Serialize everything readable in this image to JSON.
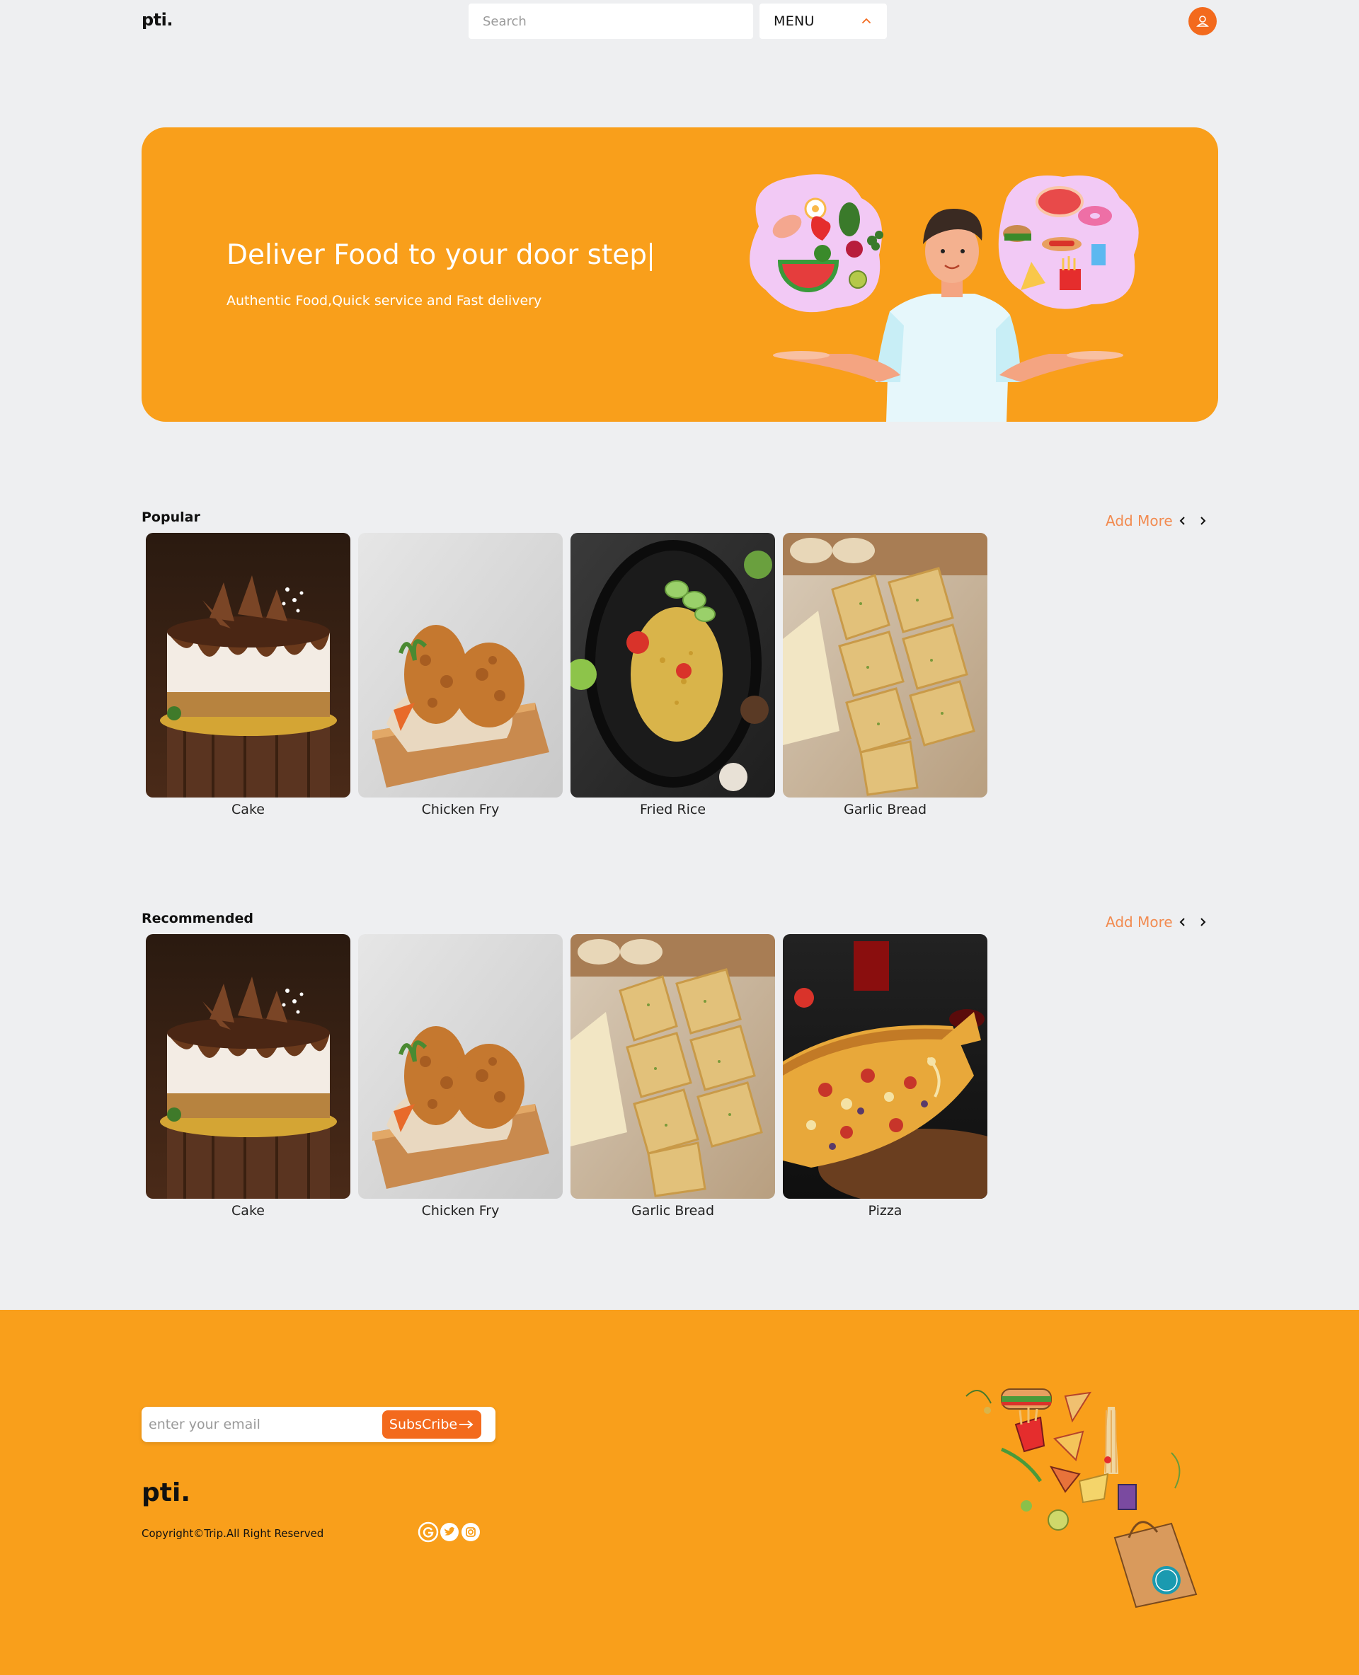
{
  "header": {
    "logo": "pti.",
    "search_placeholder": "Search",
    "menu_label": "MENU"
  },
  "hero": {
    "title": "Deliver Food to your door step",
    "subtitle": "Authentic Food,Quick service and Fast delivery"
  },
  "popular": {
    "title": "Popular",
    "add_more": "Add More",
    "items": [
      {
        "label": "Cake"
      },
      {
        "label": "Chicken Fry"
      },
      {
        "label": "Fried Rice"
      },
      {
        "label": "Garlic Bread"
      }
    ]
  },
  "recommended": {
    "title": "Recommended",
    "add_more": "Add More",
    "items": [
      {
        "label": "Cake"
      },
      {
        "label": "Chicken Fry"
      },
      {
        "label": "Garlic Bread"
      },
      {
        "label": "Pizza"
      }
    ]
  },
  "footer": {
    "email_placeholder": "enter your email",
    "subscribe_label": "SubsCribe",
    "logo": "pti.",
    "copyright": "Copyright©Trip.All Right Reserved",
    "socials": [
      "google-icon",
      "twitter-icon",
      "instagram-icon"
    ]
  },
  "colors": {
    "accent_orange": "#f99f1b",
    "button_orange": "#f36a1d",
    "link_orange": "#f28b50",
    "background": "#eeeff1"
  }
}
